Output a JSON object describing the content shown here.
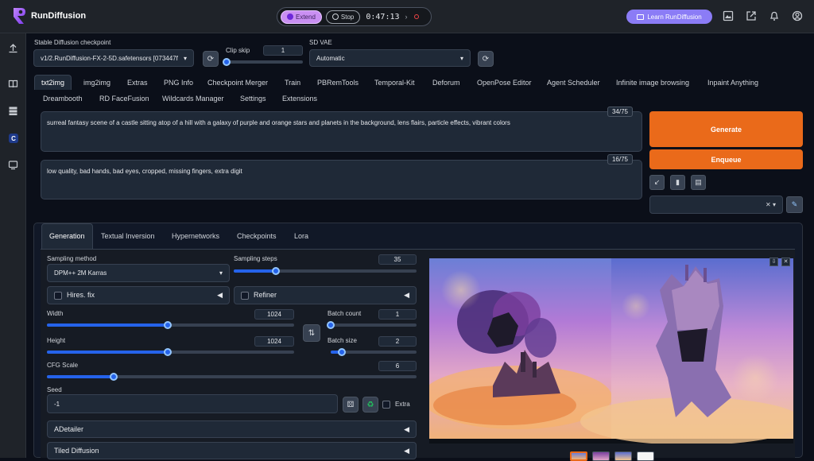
{
  "brand": {
    "name": "RunDiffusion"
  },
  "session": {
    "extend_label": "Extend",
    "stop_label": "Stop",
    "timer": "0:47:13"
  },
  "learn": {
    "label": "Learn RunDiffusion"
  },
  "icons": {
    "top": [
      "gallery-icon",
      "external-link-icon",
      "bell-icon",
      "user-icon"
    ],
    "sidebar": [
      "upload-icon",
      "book-icon",
      "database-icon",
      "civitai-icon",
      "monitor-icon"
    ]
  },
  "checkpoint": {
    "label": "Stable Diffusion checkpoint",
    "value": "v1/2.RunDiffusion-FX-2-5D.safetensors [073447f"
  },
  "clip_skip": {
    "label": "Clip skip",
    "value": "1",
    "fraction": 0.0
  },
  "vae": {
    "label": "SD VAE",
    "value": "Automatic"
  },
  "main_tabs": [
    "txt2img",
    "img2img",
    "Extras",
    "PNG Info",
    "Checkpoint Merger",
    "Train",
    "PBRemTools",
    "Temporal-Kit",
    "Deforum",
    "OpenPose Editor",
    "Agent Scheduler",
    "Infinite image browsing",
    "Inpaint Anything",
    "Dreambooth",
    "RD FaceFusion",
    "Wildcards Manager",
    "Settings",
    "Extensions"
  ],
  "prompt": {
    "text": "surreal fantasy scene of a castle sitting atop of a hill with a galaxy of purple and orange stars and planets in the background, lens flairs, particle effects, vibrant colors",
    "counter": "34/75"
  },
  "negative_prompt": {
    "text": "low quality, bad hands, bad eyes, cropped, missing fingers, extra digit",
    "counter": "16/75"
  },
  "actions": {
    "generate": "Generate",
    "enqueue": "Enqueue"
  },
  "sub_tabs": [
    "Generation",
    "Textual Inversion",
    "Hypernetworks",
    "Checkpoints",
    "Lora"
  ],
  "sampling_method": {
    "label": "Sampling method",
    "value": "DPM++ 2M Karras"
  },
  "sampling_steps": {
    "label": "Sampling steps",
    "value": "35",
    "fraction": 0.23
  },
  "hires": {
    "label": "Hires. fix"
  },
  "refiner": {
    "label": "Refiner"
  },
  "width": {
    "label": "Width",
    "value": "1024",
    "fraction": 0.49
  },
  "height": {
    "label": "Height",
    "value": "1024",
    "fraction": 0.49
  },
  "batch_count": {
    "label": "Batch count",
    "value": "1",
    "fraction": 0.0
  },
  "batch_size": {
    "label": "Batch size",
    "value": "2",
    "fraction": 0.13
  },
  "cfg": {
    "label": "CFG Scale",
    "value": "6",
    "fraction": 0.18
  },
  "seed": {
    "label": "Seed",
    "value": "-1",
    "extra_label": "Extra"
  },
  "adetailer": {
    "label": "ADetailer"
  },
  "tiled": {
    "label": "Tiled Diffusion"
  },
  "colors": {
    "accent": "#ea6a1a",
    "slider": "#2563eb",
    "background": "#0b0f19"
  }
}
